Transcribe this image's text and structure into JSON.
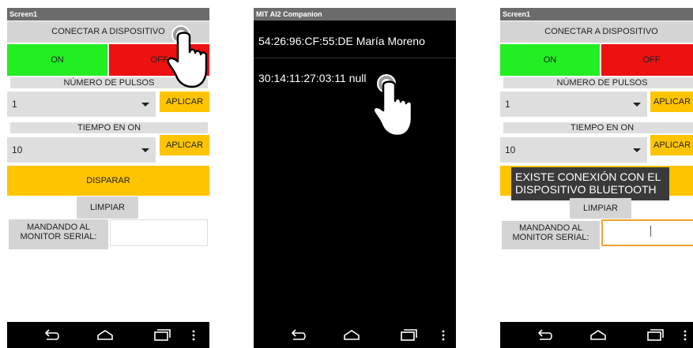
{
  "phone1": {
    "title": "Screen1",
    "connect_label": "CONECTAR A DISPOSITIVO",
    "on_label": "ON",
    "off_label": "OFF",
    "pulses_label": "NÚMERO DE PULSOS",
    "pulses_value": "1",
    "apply1_label": "APLICAR",
    "time_label": "TIEMPO EN ON",
    "time_value": "10",
    "apply2_label": "APLICAR",
    "fire_label": "DISPARAR",
    "clear_label": "LIMPIAR",
    "serial_label": "MANDANDO AL MONITOR SERIAL:",
    "serial_value": ""
  },
  "phone2": {
    "title": "MIT AI2 Companion",
    "devices": [
      "54:26:96:CF:55:DE María Moreno",
      "30:14:11:27:03:11 null"
    ]
  },
  "phone3": {
    "title": "Screen1",
    "connect_label": "CONECTAR A DISPOSITIVO",
    "on_label": "ON",
    "off_label": "OFF",
    "pulses_label": "NÚMERO DE PULSOS",
    "pulses_value": "1",
    "apply1_label": "APLICAR",
    "time_label": "TIEMPO EN ON",
    "time_value": "10",
    "apply2_label": "APLICAR",
    "toast": "EXISTE CONEXIÓN CON EL DISPOSITIVO BLUETOOTH",
    "clear_label": "LIMPIAR",
    "serial_label": "MANDANDO AL MONITOR SERIAL:",
    "serial_value": ""
  },
  "nav_icons": [
    "back-icon",
    "home-icon",
    "recents-icon",
    "menu-icon"
  ]
}
